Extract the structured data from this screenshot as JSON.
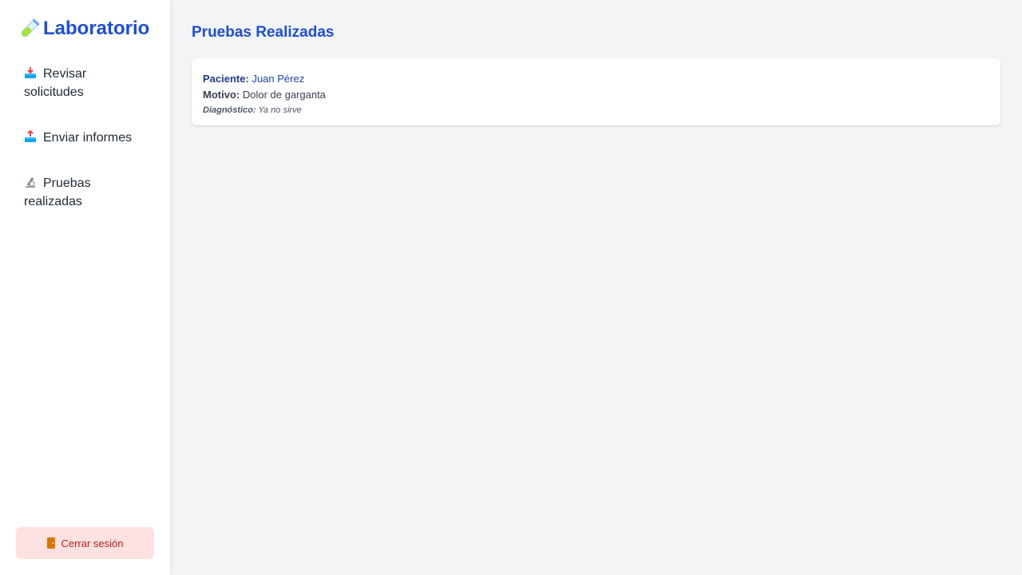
{
  "sidebar": {
    "brand": "Laboratorio",
    "items": [
      {
        "label": "Revisar solicitudes"
      },
      {
        "label": "Enviar informes"
      },
      {
        "label": "Pruebas realizadas"
      }
    ],
    "logout": "Cerrar sesión"
  },
  "main": {
    "title": "Pruebas Realizadas",
    "records": [
      {
        "patient_label": "Paciente:",
        "patient": "Juan Pérez",
        "reason_label": "Motivo:",
        "reason": "Dolor de garganta",
        "diagnosis_label": "Diagnóstico:",
        "diagnosis": "Ya no sirve"
      }
    ]
  },
  "colors": {
    "accent": "#1d4ed8",
    "background": "#f3f4f6",
    "logout_bg": "#fee2e2",
    "logout_text": "#b91c1c"
  },
  "icons": {
    "brand": "test-tube-icon",
    "revisar": "inbox-tray-icon",
    "enviar": "outbox-tray-icon",
    "pruebas": "microscope-icon",
    "logout": "door-icon"
  }
}
